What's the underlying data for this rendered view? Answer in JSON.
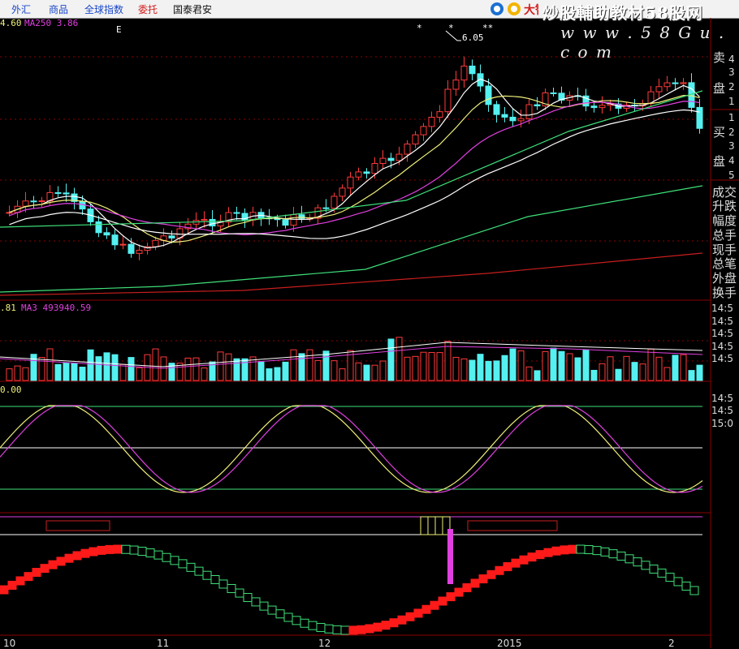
{
  "toolbar": {
    "tabs": [
      {
        "label": "外汇",
        "color": "#1a47c9"
      },
      {
        "label": "商品",
        "color": "#1a47c9"
      },
      {
        "label": "全球指数",
        "color": "#1a47c9"
      },
      {
        "label": "委托",
        "color": "#d21c1c"
      },
      {
        "label": "国泰君安",
        "color": "#111111"
      }
    ],
    "logo_text": "大智"
  },
  "watermark": {
    "brand": "炒股輔助教材58股网",
    "url": "w w w . 5 8 G u . c o m"
  },
  "main_panel": {
    "indicator_prefix": "4.60",
    "indicator_label": "MA250 3.86",
    "peak_label": "6.05",
    "marker_e": "E",
    "marker_star": "*",
    "marker_double_star": "**",
    "axis_numbers": [
      "4",
      "3",
      "2",
      "1",
      "1",
      "2",
      "3",
      "4",
      "5"
    ]
  },
  "side_panel": {
    "sell_label_1": "卖",
    "sell_label_2": "盘",
    "buy_label_1": "买",
    "buy_label_2": "盘",
    "stats": [
      "成交",
      "升跌",
      "幅度",
      "总手",
      "现手",
      "总笔",
      "外盘",
      "换手"
    ],
    "times": [
      "14:5",
      "14:5",
      "14:5",
      "14:5",
      "14:5",
      "14:5",
      "14:5",
      "15:0"
    ]
  },
  "volume_panel": {
    "prefix": ".81",
    "label": "MA3 493940.59"
  },
  "kdj_panel": {
    "value": "0.00"
  },
  "time_axis": [
    "10",
    "11",
    "12",
    "2015",
    "2"
  ],
  "colors": {
    "up": "#ff3a3a",
    "down": "#55f0f0",
    "ma_white": "#ffffff",
    "ma_yellow": "#f0f07a",
    "ma_magenta": "#e040e0",
    "ma_green": "#3fe07a",
    "ma_red": "#c81e1e",
    "grid": "#8b0000"
  }
}
